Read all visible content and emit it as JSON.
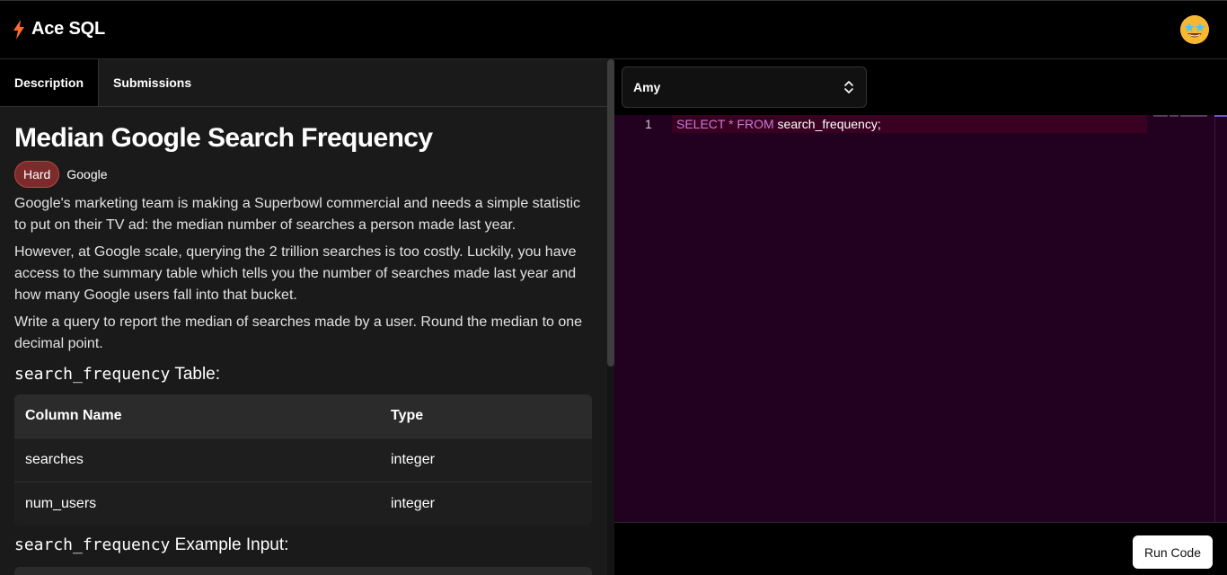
{
  "app": {
    "title": "Ace SQL",
    "brand_color": "#ff6a2b"
  },
  "header": {
    "avatar_icon": "star-struck-emoji-icon"
  },
  "tabs": [
    {
      "label": "Description",
      "active": true
    },
    {
      "label": "Submissions",
      "active": false
    }
  ],
  "problem": {
    "title": "Median Google Search Frequency",
    "difficulty": "Hard",
    "company": "Google",
    "paragraphs": [
      "Google's marketing team is making a Superbowl commercial and needs a simple statistic to put on their TV ad: the median number of searches a person made last year.",
      "However, at Google scale, querying the 2 trillion searches is too costly. Luckily, you have access to the summary table which tells you the number of searches made last year and how many Google users fall into that bucket.",
      "Write a query to report the median of searches made by a user. Round the median to one decimal point."
    ],
    "table_name": "search_frequency",
    "table_suffix": " Table:",
    "example_suffix": " Example Input:",
    "columns_header": [
      "Column Name",
      "Type"
    ],
    "columns": [
      [
        "searches",
        "integer"
      ],
      [
        "num_users",
        "integer"
      ]
    ]
  },
  "editor": {
    "dialect_selected": "Amy",
    "line_number": "1",
    "code_keyword_1": "SELECT * FROM",
    "code_rest": " search_frequency;",
    "background": "#22001f"
  },
  "actions": {
    "run_label": "Run Code"
  }
}
